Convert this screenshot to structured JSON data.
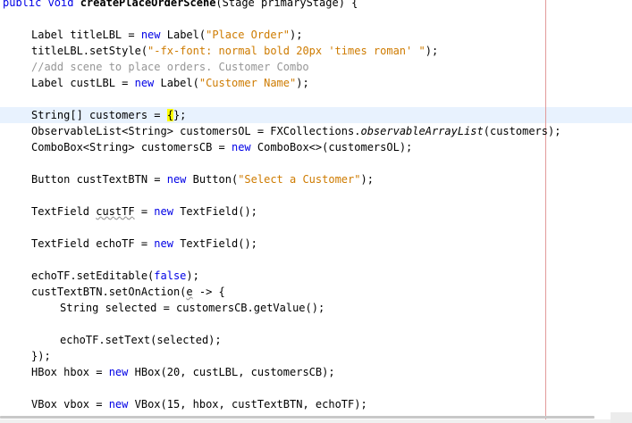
{
  "editor": {
    "lines": {
      "method_sig_pre": "public void ",
      "method_sig_name": "createPlaceOrderScene",
      "method_sig_post": "(Stage primaryStage) {",
      "l1_a": "Label titleLBL = ",
      "l1_kw": "new",
      "l1_b": " Label(",
      "l1_str": "\"Place Order\"",
      "l1_c": ");",
      "l2_a": "titleLBL.setStyle(",
      "l2_str": "\"-fx-font: normal bold 20px 'times roman' \"",
      "l2_b": ");",
      "l3_comment": "//add scene to place orders. Customer Combo",
      "l4_a": "Label custLBL = ",
      "l4_kw": "new",
      "l4_b": " Label(",
      "l4_str": "\"Customer Name\"",
      "l4_c": ");",
      "l5_a": "String[] customers = ",
      "l5_caret": "{",
      "l5_b": "};",
      "l6_a": "ObservableList<String> customersOL = FXCollections.",
      "l6_it": "observableArrayList",
      "l6_b": "(customers);",
      "l7_a": "ComboBox<String> customersCB = ",
      "l7_kw": "new",
      "l7_b": " ComboBox<>(customersOL);",
      "l8_a": "Button custTextBTN = ",
      "l8_kw": "new",
      "l8_b": " Button(",
      "l8_str": "\"Select a Customer\"",
      "l8_c": ");",
      "l9_a": "TextField ",
      "l9_sq": "custTF",
      "l9_b": " = ",
      "l9_kw": "new",
      "l9_c": " TextField();",
      "l10_a": "TextField echoTF = ",
      "l10_kw": "new",
      "l10_b": " TextField();",
      "l11_a": "echoTF.setEditable(",
      "l11_kw": "false",
      "l11_b": ");",
      "l12_a": "custTextBTN.setOnAction(",
      "l12_sq": "e",
      "l12_b": " -> {",
      "l13_a": "String selected = customersCB.getValue();",
      "l14_a": "echoTF.setText(selected);",
      "l15_a": "});",
      "l16_a": "HBox hbox = ",
      "l16_kw": "new",
      "l16_b": " HBox(20, custLBL, customersCB);",
      "l17_a": "VBox vbox = ",
      "l17_kw": "new",
      "l17_b": " VBox(15, hbox, custTextBTN, echoTF);"
    }
  }
}
